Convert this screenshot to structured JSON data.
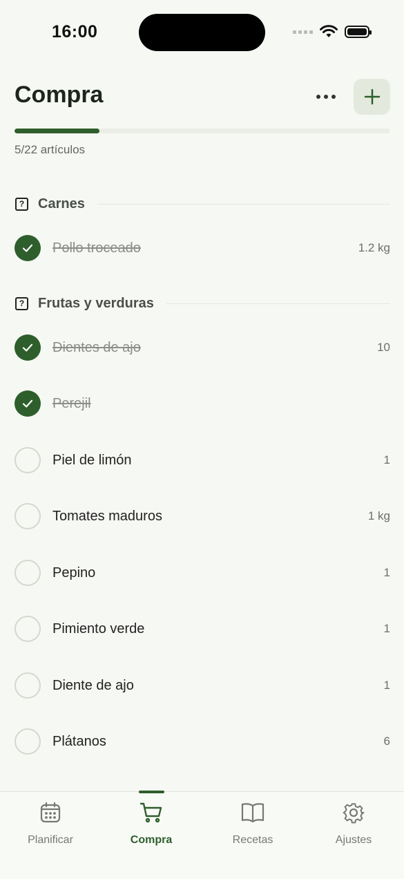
{
  "status_bar": {
    "time": "16:00"
  },
  "header": {
    "title": "Compra",
    "progress_text": "5/22 artículos",
    "progress_fraction": 0.227
  },
  "sections": [
    {
      "label": "Carnes",
      "items": [
        {
          "name": "Pollo troceado",
          "qty": "1.2 kg",
          "checked": true
        }
      ]
    },
    {
      "label": "Frutas y verduras",
      "items": [
        {
          "name": "Dientes de ajo",
          "qty": "10",
          "checked": true
        },
        {
          "name": "Perejil",
          "qty": "",
          "checked": true
        },
        {
          "name": "Piel de limón",
          "qty": "1",
          "checked": false
        },
        {
          "name": "Tomates maduros",
          "qty": "1 kg",
          "checked": false
        },
        {
          "name": "Pepino",
          "qty": "1",
          "checked": false
        },
        {
          "name": "Pimiento verde",
          "qty": "1",
          "checked": false
        },
        {
          "name": "Diente de ajo",
          "qty": "1",
          "checked": false
        },
        {
          "name": "Plátanos",
          "qty": "6",
          "checked": false
        }
      ]
    }
  ],
  "tabs": [
    {
      "label": "Planificar",
      "icon": "calendar-icon",
      "active": false
    },
    {
      "label": "Compra",
      "icon": "cart-icon",
      "active": true
    },
    {
      "label": "Recetas",
      "icon": "book-icon",
      "active": false
    },
    {
      "label": "Ajustes",
      "icon": "gear-icon",
      "active": false
    }
  ],
  "colors": {
    "accent": "#2e5e2c",
    "background": "#f6f8f3"
  }
}
